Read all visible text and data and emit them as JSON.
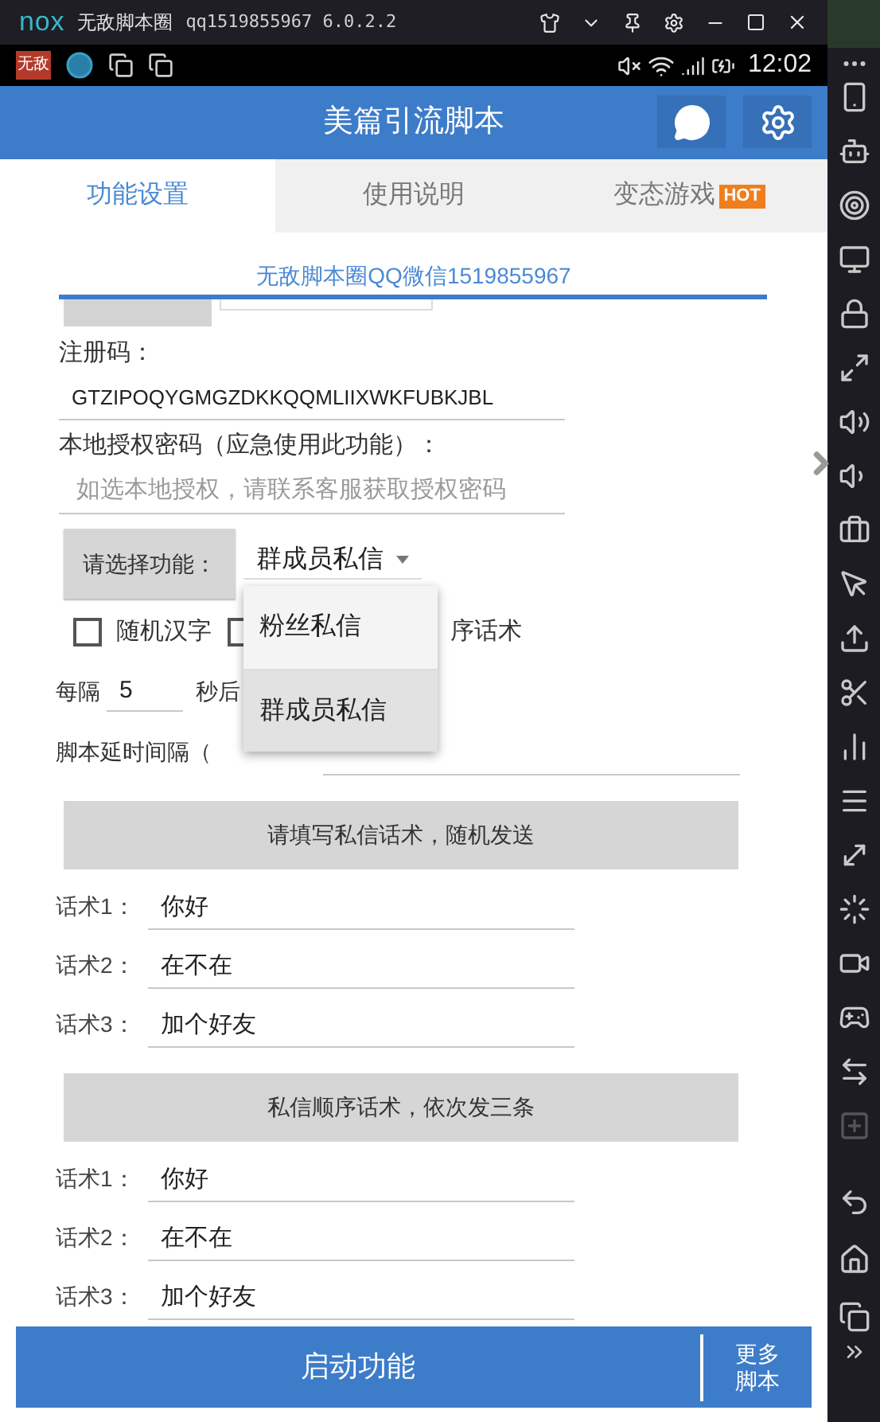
{
  "emulator": {
    "logo": "nox",
    "title": "无敌脚本圈",
    "info": "qq1519855967 6.0.2.2"
  },
  "status_bar": {
    "app_badge": "无敌",
    "time": "12:02"
  },
  "app": {
    "title": "美篇引流脚本"
  },
  "tabs": [
    {
      "label": "功能设置",
      "selected": true
    },
    {
      "label": "使用说明",
      "selected": false
    },
    {
      "label": "变态游戏",
      "badge": "HOT",
      "selected": false
    }
  ],
  "banner": "无敌脚本圈QQ微信1519855967",
  "registration": {
    "label": "注册码：",
    "value": "GTZIPOQYGMGZDKKQQMLIIXWKFUBKJBL"
  },
  "local_auth": {
    "label": "本地授权密码（应急使用此功能）：",
    "placeholder": "如选本地授权，请联系客服获取授权密码"
  },
  "function_select": {
    "button": "请选择功能：",
    "value": "群成员私信",
    "expanded": true,
    "options": [
      {
        "label": "粉丝私信",
        "selected": false
      },
      {
        "label": "群成员私信",
        "selected": true
      }
    ]
  },
  "checkboxes": [
    {
      "label": "随机汉字",
      "checked": false
    },
    {
      "label": "序话术",
      "checked": false
    }
  ],
  "interval": {
    "prefix": "每隔",
    "value": "5",
    "suffix": "秒后"
  },
  "delay": {
    "label": "脚本延时间隔（"
  },
  "sections": [
    {
      "header": "请填写私信话术，随机发送",
      "scripts": [
        {
          "label": "话术1：",
          "value": "你好"
        },
        {
          "label": "话术2：",
          "value": "在不在"
        },
        {
          "label": "话术3：",
          "value": "加个好友"
        }
      ]
    },
    {
      "header": "私信顺序话术，依次发三条",
      "scripts": [
        {
          "label": "话术1：",
          "value": "你好"
        },
        {
          "label": "话术2：",
          "value": "在不在"
        },
        {
          "label": "话术3：",
          "value": "加个好友"
        }
      ]
    }
  ],
  "bottom_bar": {
    "start": "启动功能",
    "more": "更多脚本"
  }
}
